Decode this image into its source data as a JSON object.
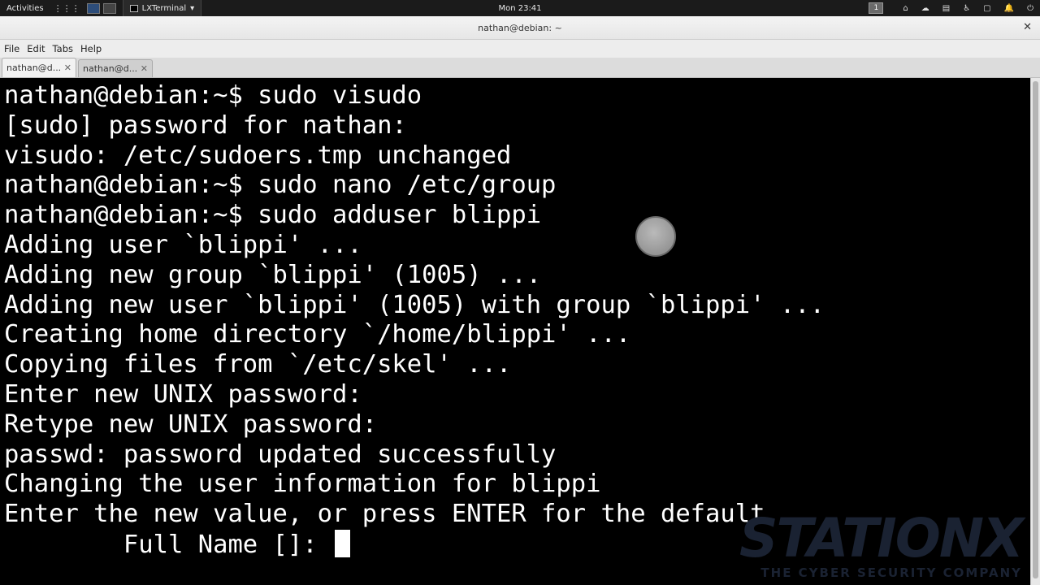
{
  "topbar": {
    "activities": "Activities",
    "app_name": "LXTerminal",
    "app_dropdown": "▾",
    "clock": "Mon 23:41",
    "workspace": "1",
    "tray": [
      "⌂",
      "☁",
      "▤",
      "♿",
      "▢",
      "🔔",
      "⏻"
    ]
  },
  "window": {
    "title": "nathan@debian: ~",
    "close_glyph": "✕"
  },
  "menu": [
    "File",
    "Edit",
    "Tabs",
    "Help"
  ],
  "tabs": [
    {
      "label": "nathan@d...",
      "close": "✕"
    },
    {
      "label": "nathan@d...",
      "close": "✕"
    }
  ],
  "terminal": {
    "lines": [
      "nathan@debian:~$ sudo visudo",
      "[sudo] password for nathan:",
      "visudo: /etc/sudoers.tmp unchanged",
      "nathan@debian:~$ sudo nano /etc/group",
      "nathan@debian:~$ sudo adduser blippi",
      "Adding user `blippi' ...",
      "Adding new group `blippi' (1005) ...",
      "Adding new user `blippi' (1005) with group `blippi' ...",
      "Creating home directory `/home/blippi' ...",
      "Copying files from `/etc/skel' ...",
      "Enter new UNIX password:",
      "Retype new UNIX password:",
      "passwd: password updated successfully",
      "Changing the user information for blippi",
      "Enter the new value, or press ENTER for the default",
      "        Full Name []: "
    ]
  },
  "watermark": {
    "main": "STATIONX",
    "sub": "THE CYBER SECURITY COMPANY"
  }
}
